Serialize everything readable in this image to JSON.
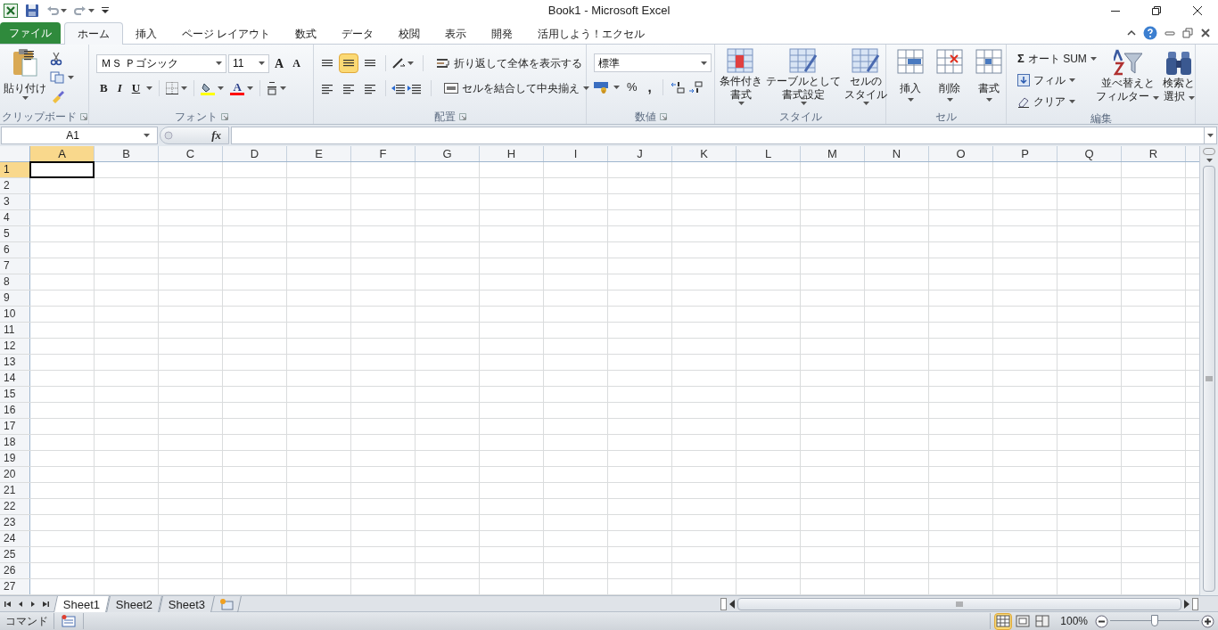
{
  "title": "Book1  -  Microsoft Excel",
  "tabs": [
    {
      "label": "ファイル",
      "kind": "file",
      "selected": false
    },
    {
      "label": "ホーム",
      "kind": "tab",
      "selected": true
    },
    {
      "label": "挿入",
      "kind": "tab",
      "selected": false
    },
    {
      "label": "ページ レイアウト",
      "kind": "tab",
      "selected": false
    },
    {
      "label": "数式",
      "kind": "tab",
      "selected": false
    },
    {
      "label": "データ",
      "kind": "tab",
      "selected": false
    },
    {
      "label": "校閲",
      "kind": "tab",
      "selected": false
    },
    {
      "label": "表示",
      "kind": "tab",
      "selected": false
    },
    {
      "label": "開発",
      "kind": "tab",
      "selected": false
    },
    {
      "label": "活用しよう！エクセル",
      "kind": "tab",
      "selected": false
    }
  ],
  "clipboard": {
    "label": "クリップボード",
    "paste": "貼り付け"
  },
  "font": {
    "label": "フォント",
    "font_name": "ＭＳ Ｐゴシック",
    "font_size": "11",
    "grow": "A",
    "shrink": "A",
    "bold": "B",
    "italic": "I",
    "underline": "U",
    "font_color": "A"
  },
  "alignment": {
    "label": "配置",
    "vertical": [
      {
        "selected": false
      },
      {
        "selected": true
      },
      {
        "selected": false
      }
    ],
    "wrap": "折り返して全体を表示する",
    "merge": "セルを結合して中央揃え"
  },
  "number": {
    "label": "数値",
    "format": "標準",
    "percent": "%",
    "comma": ","
  },
  "styles": {
    "label": "スタイル",
    "buttons": [
      {
        "lines": [
          "条件付き",
          "書式"
        ]
      },
      {
        "lines": [
          "テーブルとして",
          "書式設定"
        ]
      },
      {
        "lines": [
          "セルの",
          "スタイル"
        ]
      }
    ]
  },
  "cells": {
    "label": "セル",
    "buttons": [
      "挿入",
      "削除",
      "書式"
    ]
  },
  "editing": {
    "label": "編集",
    "sigma": "Σ",
    "autosum": "オート SUM",
    "fill": "フィル",
    "clear": "クリア",
    "sort": [
      "並べ替えと",
      "フィルター"
    ],
    "find": [
      "検索と",
      "選択"
    ]
  },
  "formula_bar": {
    "name_box": "A1",
    "fx": "fx"
  },
  "columns": [
    {
      "label": "A",
      "selected": true
    },
    {
      "label": "B",
      "selected": false
    },
    {
      "label": "C",
      "selected": false
    },
    {
      "label": "D",
      "selected": false
    },
    {
      "label": "E",
      "selected": false
    },
    {
      "label": "F",
      "selected": false
    },
    {
      "label": "G",
      "selected": false
    },
    {
      "label": "H",
      "selected": false
    },
    {
      "label": "I",
      "selected": false
    },
    {
      "label": "J",
      "selected": false
    },
    {
      "label": "K",
      "selected": false
    },
    {
      "label": "L",
      "selected": false
    },
    {
      "label": "M",
      "selected": false
    },
    {
      "label": "N",
      "selected": false
    },
    {
      "label": "O",
      "selected": false
    },
    {
      "label": "P",
      "selected": false
    },
    {
      "label": "Q",
      "selected": false
    },
    {
      "label": "R",
      "selected": false
    }
  ],
  "rows": [
    {
      "label": "1",
      "selected": true
    },
    {
      "label": "2",
      "selected": false
    },
    {
      "label": "3",
      "selected": false
    },
    {
      "label": "4",
      "selected": false
    },
    {
      "label": "5",
      "selected": false
    },
    {
      "label": "6",
      "selected": false
    },
    {
      "label": "7",
      "selected": false
    },
    {
      "label": "8",
      "selected": false
    },
    {
      "label": "9",
      "selected": false
    },
    {
      "label": "10",
      "selected": false
    },
    {
      "label": "11",
      "selected": false
    },
    {
      "label": "12",
      "selected": false
    },
    {
      "label": "13",
      "selected": false
    },
    {
      "label": "14",
      "selected": false
    },
    {
      "label": "15",
      "selected": false
    },
    {
      "label": "16",
      "selected": false
    },
    {
      "label": "17",
      "selected": false
    },
    {
      "label": "18",
      "selected": false
    },
    {
      "label": "19",
      "selected": false
    },
    {
      "label": "20",
      "selected": false
    },
    {
      "label": "21",
      "selected": false
    },
    {
      "label": "22",
      "selected": false
    },
    {
      "label": "23",
      "selected": false
    },
    {
      "label": "24",
      "selected": false
    },
    {
      "label": "25",
      "selected": false
    },
    {
      "label": "26",
      "selected": false
    },
    {
      "label": "27",
      "selected": false
    }
  ],
  "sheets": [
    {
      "label": "Sheet1",
      "selected": true
    },
    {
      "label": "Sheet2",
      "selected": false
    },
    {
      "label": "Sheet3",
      "selected": false
    }
  ],
  "status_bar": {
    "mode": "コマンド",
    "views": [
      {
        "selected": true
      },
      {
        "selected": false
      },
      {
        "selected": false
      }
    ],
    "zoom": "100%",
    "zoom_slider": {
      "level": 0.5
    }
  }
}
